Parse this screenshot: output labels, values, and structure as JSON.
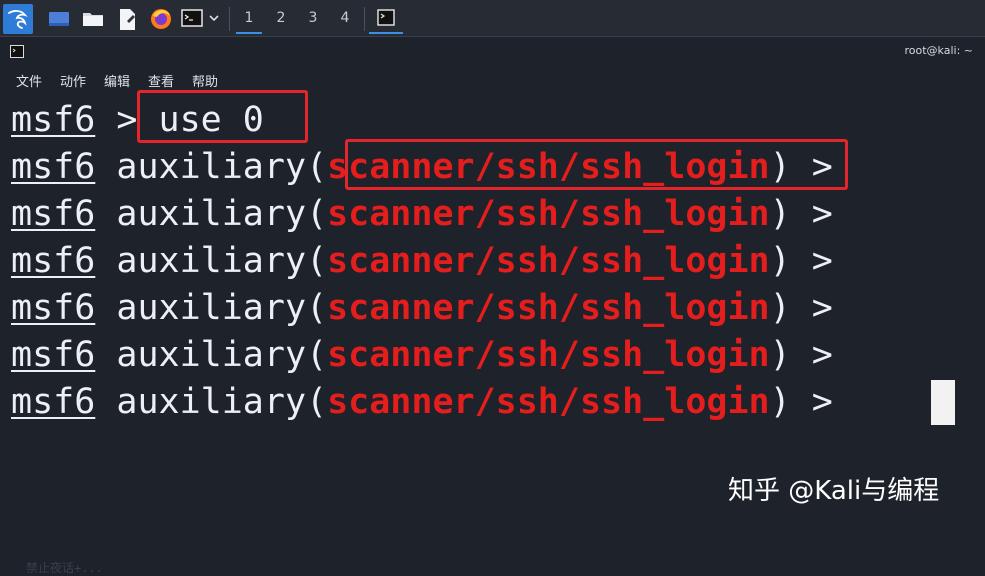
{
  "taskbar": {
    "workspaces": [
      "1",
      "2",
      "3",
      "4"
    ],
    "active_workspace": "1",
    "apps": [
      "kali-menu-icon",
      "desktop-icon",
      "file-manager-icon",
      "text-editor-icon",
      "firefox-icon",
      "terminal-icon"
    ]
  },
  "window": {
    "title": "root@kali: ~"
  },
  "menu": {
    "items": [
      "文件",
      "动作",
      "编辑",
      "查看",
      "帮助"
    ]
  },
  "terminal": {
    "prompt_base": "msf6",
    "first_command": " > use 0",
    "context_prefix": " auxiliary(",
    "module": "scanner/ssh/ssh_login",
    "context_suffix": ") >",
    "repeat_lines": 6
  },
  "watermark": {
    "text": "知乎 @Kali与编程"
  },
  "ghost_text": "禁止夜话+...",
  "colors": {
    "background": "#1d222b",
    "module_red": "#e41d1d",
    "highlight_box": "#e3262b",
    "accent_blue": "#2f7cd6"
  }
}
